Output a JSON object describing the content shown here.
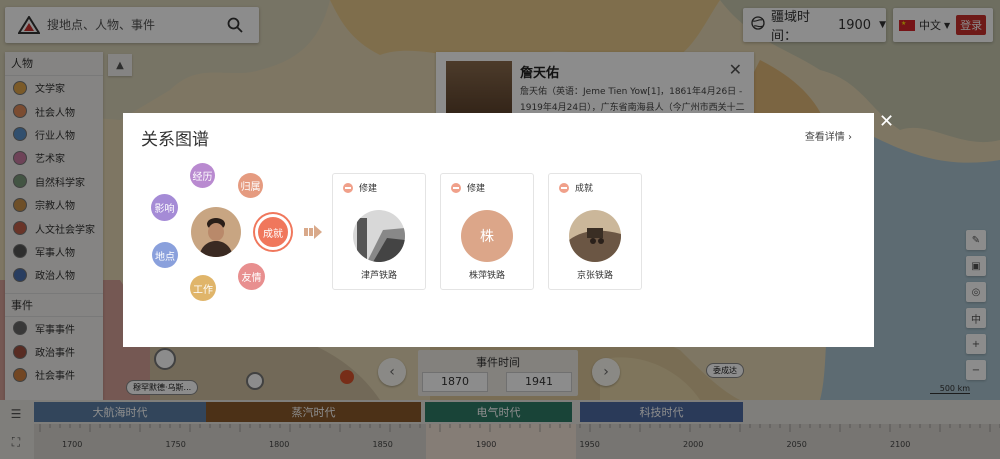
{
  "search": {
    "placeholder": "搜地点、人物、事件"
  },
  "territory": {
    "label": "疆域时间：",
    "year": "1900"
  },
  "language": "中文",
  "login_label": "登录",
  "sidebar": {
    "people_title": "人物",
    "people": [
      {
        "label": "文学家",
        "color": "#e0a44a"
      },
      {
        "label": "社会人物",
        "color": "#e08a5a"
      },
      {
        "label": "行业人物",
        "color": "#5a90c8"
      },
      {
        "label": "艺术家",
        "color": "#c87aa0"
      },
      {
        "label": "自然科学家",
        "color": "#7a9a7a"
      },
      {
        "label": "宗教人物",
        "color": "#c8904a"
      },
      {
        "label": "人文社会学家",
        "color": "#c0604a"
      },
      {
        "label": "军事人物",
        "color": "#555555"
      },
      {
        "label": "政治人物",
        "color": "#4a70b0"
      }
    ],
    "events_title": "事件",
    "events": [
      {
        "label": "军事事件",
        "color": "#666666"
      },
      {
        "label": "政治事件",
        "color": "#a05040"
      },
      {
        "label": "社会事件",
        "color": "#d08040"
      }
    ]
  },
  "person_card": {
    "name": "詹天佑",
    "description": "詹天佑（英语：Jeme Tien Yow[1]，1861年4月26日 - 1919年4月24日），广东省南海县人（今广州市西关十二"
  },
  "modal": {
    "title": "关系图谱",
    "detail_link": "查看详情",
    "bubbles": {
      "experience": "经历",
      "belong": "归属",
      "influence": "影响",
      "achievement": "成就",
      "place": "地点",
      "friendship": "友情",
      "work": "工作"
    },
    "cards": [
      {
        "tag": "修建",
        "name": "津芦铁路",
        "type": "photo"
      },
      {
        "tag": "修建",
        "name": "株萍铁路",
        "type": "initial",
        "initial": "株"
      },
      {
        "tag": "成就",
        "name": "京张铁路",
        "type": "photo"
      }
    ]
  },
  "event_time": {
    "title": "事件时间",
    "start": "1870",
    "end": "1941"
  },
  "map_labels": {
    "left": "穆罕默德·乌斯...",
    "right": "委成达"
  },
  "scale_label": "500 km",
  "timeline": {
    "eras": [
      {
        "label": "大航海时代",
        "color": "#5b7fa6"
      },
      {
        "label": "蒸汽时代",
        "color": "#8a5a2a"
      },
      {
        "label": "电气时代",
        "color": "#2e7c67"
      },
      {
        "label": "科技时代",
        "color": "#4d6aa3"
      }
    ],
    "ticks": [
      "1700",
      "1750",
      "1800",
      "1850",
      "1900",
      "1950",
      "2000",
      "2050",
      "2100"
    ]
  }
}
